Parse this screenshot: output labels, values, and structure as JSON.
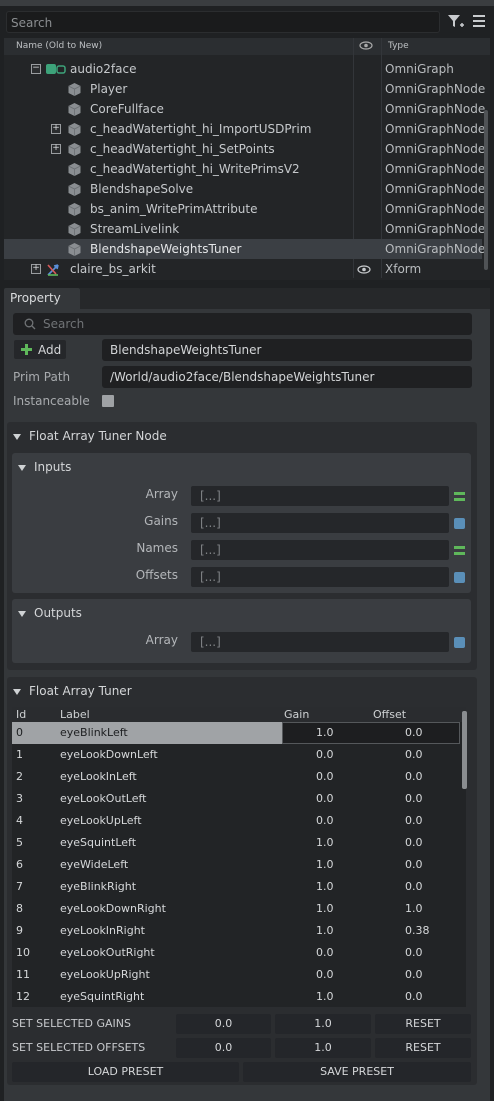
{
  "stage": {
    "search_placeholder": "Search",
    "columns": {
      "name": "Name (Old to New)",
      "type": "Type"
    },
    "rows": [
      {
        "label": "audio2face",
        "type": "OmniGraph"
      },
      {
        "label": "Player",
        "type": "OmniGraphNode"
      },
      {
        "label": "CoreFullface",
        "type": "OmniGraphNode"
      },
      {
        "label": "c_headWatertight_hi_ImportUSDPrim",
        "type": "OmniGraphNode"
      },
      {
        "label": "c_headWatertight_hi_SetPoints",
        "type": "OmniGraphNode"
      },
      {
        "label": "c_headWatertight_hi_WritePrimsV2",
        "type": "OmniGraphNode"
      },
      {
        "label": "BlendshapeSolve",
        "type": "OmniGraphNode"
      },
      {
        "label": "bs_anim_WritePrimAttribute",
        "type": "OmniGraphNode"
      },
      {
        "label": "StreamLivelink",
        "type": "OmniGraphNode"
      },
      {
        "label": "BlendshapeWeightsTuner",
        "type": "OmniGraphNode"
      },
      {
        "label": "claire_bs_arkit",
        "type": "Xform"
      }
    ]
  },
  "property": {
    "tab": "Property",
    "search_placeholder": "Search",
    "add_label": "Add",
    "prim_name": "BlendshapeWeightsTuner",
    "prim_path_label": "Prim Path",
    "prim_path": "/World/audio2face/BlendshapeWeightsTuner",
    "instanceable_label": "Instanceable",
    "node_section": "Float Array Tuner Node",
    "inputs_title": "Inputs",
    "inputs": [
      {
        "label": "Array",
        "value": "[...]"
      },
      {
        "label": "Gains",
        "value": "[...]"
      },
      {
        "label": "Names",
        "value": "[...]"
      },
      {
        "label": "Offsets",
        "value": "[...]"
      }
    ],
    "outputs_title": "Outputs",
    "outputs": [
      {
        "label": "Array",
        "value": "[...]"
      }
    ],
    "tuner_section": "Float Array Tuner",
    "grid_headers": {
      "id": "Id",
      "label": "Label",
      "gain": "Gain",
      "offset": "Offset"
    },
    "grid_rows": [
      {
        "id": "0",
        "label": "eyeBlinkLeft",
        "gain": "1.0",
        "offset": "0.0"
      },
      {
        "id": "1",
        "label": "eyeLookDownLeft",
        "gain": "0.0",
        "offset": "0.0"
      },
      {
        "id": "2",
        "label": "eyeLookInLeft",
        "gain": "0.0",
        "offset": "0.0"
      },
      {
        "id": "3",
        "label": "eyeLookOutLeft",
        "gain": "0.0",
        "offset": "0.0"
      },
      {
        "id": "4",
        "label": "eyeLookUpLeft",
        "gain": "0.0",
        "offset": "0.0"
      },
      {
        "id": "5",
        "label": "eyeSquintLeft",
        "gain": "1.0",
        "offset": "0.0"
      },
      {
        "id": "6",
        "label": "eyeWideLeft",
        "gain": "1.0",
        "offset": "0.0"
      },
      {
        "id": "7",
        "label": "eyeBlinkRight",
        "gain": "1.0",
        "offset": "0.0"
      },
      {
        "id": "8",
        "label": "eyeLookDownRight",
        "gain": "1.0",
        "offset": "1.0"
      },
      {
        "id": "9",
        "label": "eyeLookInRight",
        "gain": "1.0",
        "offset": "0.38"
      },
      {
        "id": "10",
        "label": "eyeLookOutRight",
        "gain": "0.0",
        "offset": "0.0"
      },
      {
        "id": "11",
        "label": "eyeLookUpRight",
        "gain": "0.0",
        "offset": "0.0"
      },
      {
        "id": "12",
        "label": "eyeSquintRight",
        "gain": "1.0",
        "offset": "0.0"
      }
    ],
    "set_gains_label": "SET SELECTED GAINS",
    "set_gains_a": "0.0",
    "set_gains_b": "1.0",
    "set_offsets_label": "SET SELECTED OFFSETS",
    "set_offsets_a": "0.0",
    "set_offsets_b": "1.0",
    "reset_label": "RESET",
    "load_preset": "LOAD PRESET",
    "save_preset": "SAVE PRESET"
  },
  "colors": {
    "accent_green": "#5fb85b",
    "accent_blue": "#5a8fb8",
    "selection": "#3b3f44"
  }
}
